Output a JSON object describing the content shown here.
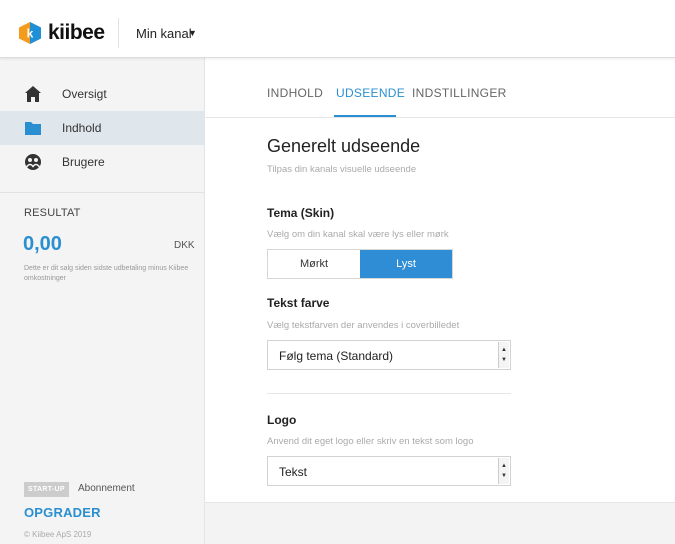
{
  "topbar": {
    "brand": "kiibee",
    "channel_label": "Min kanal",
    "channel_caret": "▼"
  },
  "sidebar": {
    "items": [
      {
        "label": "Oversigt",
        "icon": "home-icon"
      },
      {
        "label": "Indhold",
        "icon": "folder-icon"
      },
      {
        "label": "Brugere",
        "icon": "users-icon"
      }
    ],
    "active_index": 1,
    "result": {
      "label": "RESULTAT",
      "value": "0,00",
      "currency": "DKK",
      "note": "Dette er dit salg siden sidste udbetaling minus Kiibee omkostninger"
    },
    "plan_badge": "START-UP",
    "plan_label": "Abonnement",
    "upgrade_label": "OPGRADER",
    "copyright": "© Kiibee ApS 2019"
  },
  "tabs": [
    {
      "label": "INDHOLD"
    },
    {
      "label": "UDSEENDE"
    },
    {
      "label": "INDSTILLINGER"
    }
  ],
  "active_tab": "UDSEENDE",
  "section": {
    "title": "Generelt udseende",
    "subtitle": "Tilpas din kanals visuelle udseende"
  },
  "skin": {
    "title": "Tema (Skin)",
    "hint": "Vælg om din kanal skal være lys eller mørk",
    "options": [
      "Mørkt",
      "Lyst"
    ],
    "selected": "Lyst"
  },
  "text_color": {
    "title": "Tekst farve",
    "hint": "Vælg tekstfarven der anvendes i coverbilledet",
    "value": "Følg tema (Standard)"
  },
  "logo": {
    "title": "Logo",
    "hint": "Anvend dit eget logo eller skriv en tekst som logo",
    "value": "Tekst"
  },
  "colors": {
    "accent": "#2a8fd0",
    "logo_orange": "#f29b1d",
    "logo_blue": "#1f8fd8"
  }
}
